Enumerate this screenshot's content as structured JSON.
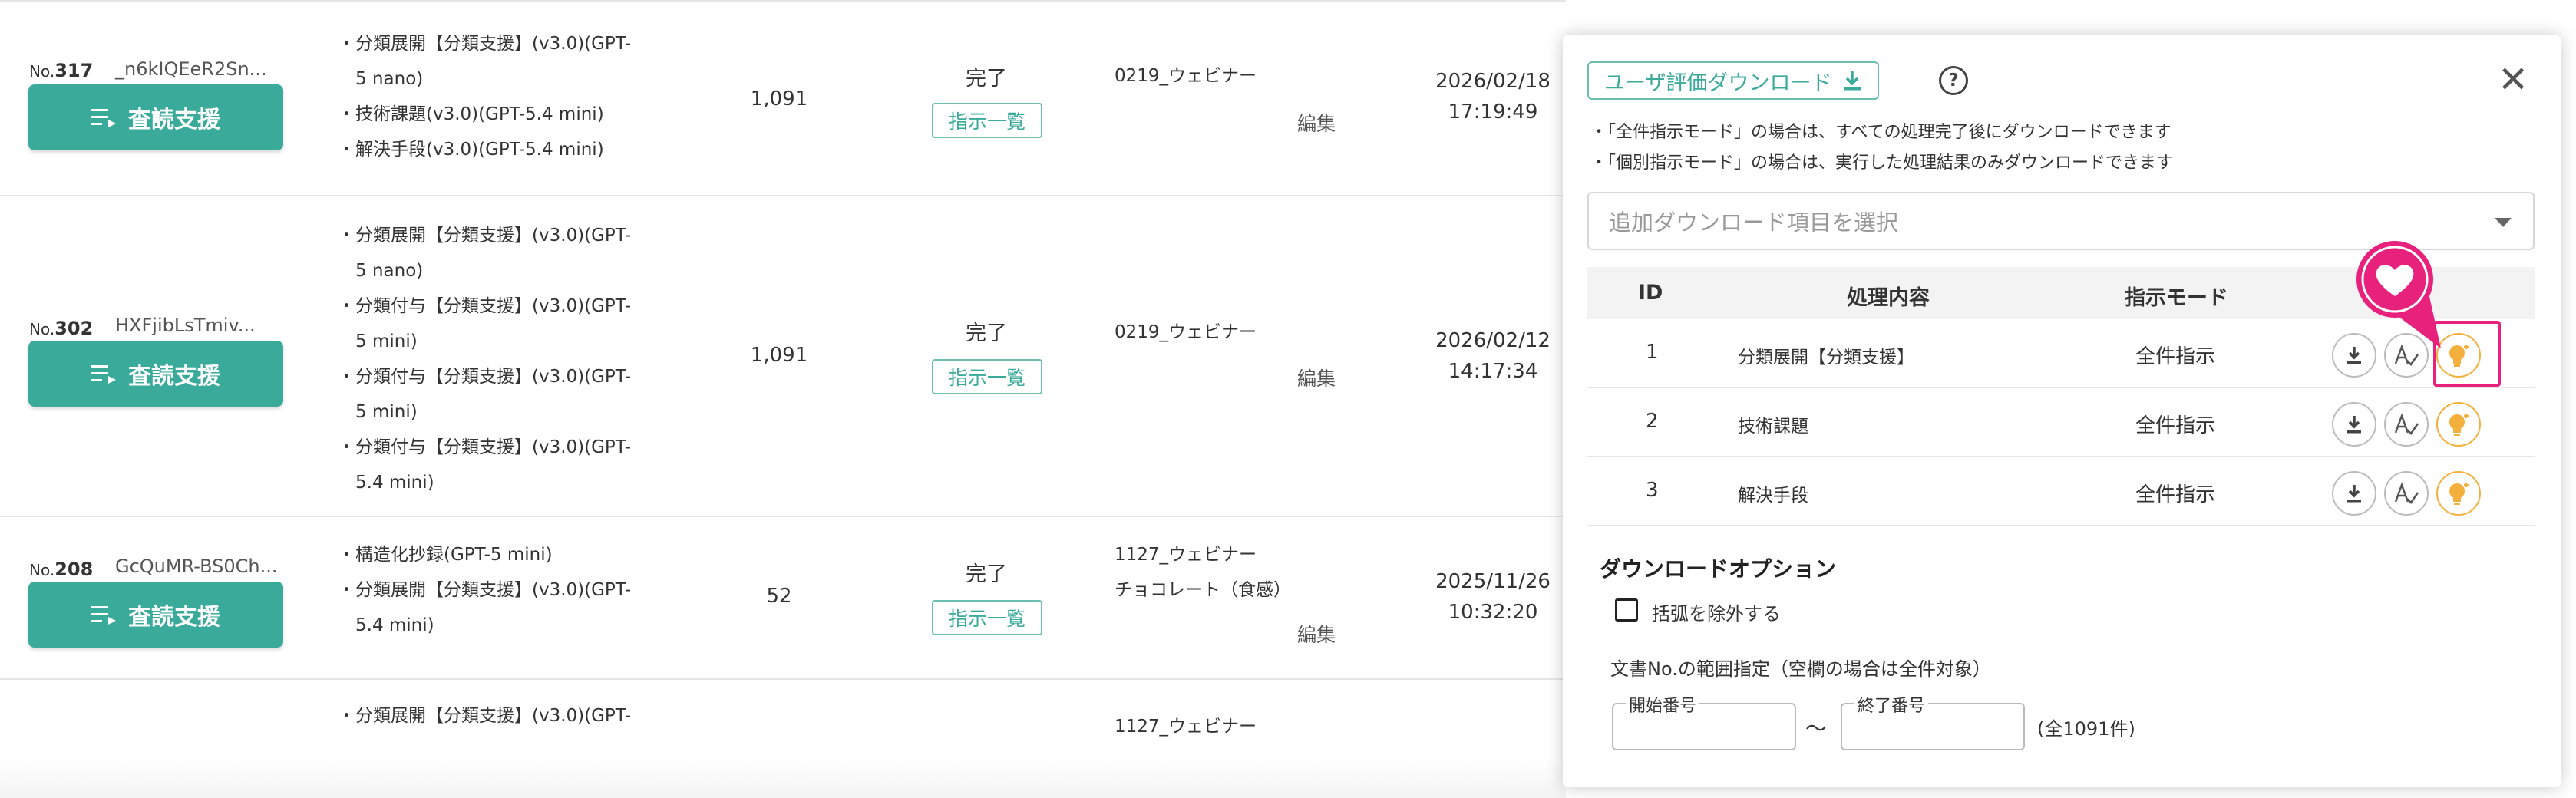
{
  "rows": [
    {
      "no_prefix": "No.",
      "no": "317",
      "code": "_n6kIQEeR2Sn...",
      "button": "査読支援",
      "tasks": [
        "・分類展開【分類支援】(v3.0)(GPT-",
        "　5 nano)",
        "・技術課題(v3.0)(GPT-5.4 mini)",
        "・解決手段(v3.0)(GPT-5.4 mini)"
      ],
      "count": "1,091",
      "status": "完了",
      "instruction_link": "指示一覧",
      "webinar": [
        "0219_ウェビナー"
      ],
      "edit": "編集",
      "date": "2026/02/18",
      "time": "17:19:49"
    },
    {
      "no_prefix": "No.",
      "no": "302",
      "code": "HXFjibLsTmiv...",
      "button": "査読支援",
      "tasks": [
        "・分類展開【分類支援】(v3.0)(GPT-",
        "　5 nano)",
        "・分類付与【分類支援】(v3.0)(GPT-",
        "　5 mini)",
        "・分類付与【分類支援】(v3.0)(GPT-",
        "　5 mini)",
        "・分類付与【分類支援】(v3.0)(GPT-",
        "　5.4 mini)"
      ],
      "count": "1,091",
      "status": "完了",
      "instruction_link": "指示一覧",
      "webinar": [
        "0219_ウェビナー"
      ],
      "edit": "編集",
      "date": "2026/02/12",
      "time": "14:17:34"
    },
    {
      "no_prefix": "No.",
      "no": "208",
      "code": "GcQuMR-BS0Ch...",
      "button": "査読支援",
      "tasks": [
        "・構造化抄録(GPT-5 mini)",
        "・分類展開【分類支援】(v3.0)(GPT-",
        "　5.4 mini)"
      ],
      "count": "52",
      "status": "完了",
      "instruction_link": "指示一覧",
      "webinar": [
        "1127_ウェビナー",
        "チョコレート（食感）"
      ],
      "edit": "編集",
      "date": "2025/11/26",
      "time": "10:32:20"
    },
    {
      "tasks": [
        "・分類展開【分類支援】(v3.0)(GPT-"
      ],
      "webinar": [
        "1127_ウェビナー"
      ]
    }
  ],
  "panel": {
    "download_button": "ユーザ評価ダウンロード",
    "help": "?",
    "close": "✕",
    "notes": [
      "・「全件指示モード」の場合は、すべての処理完了後にダウンロードできます",
      "・「個別指示モード」の場合は、実行した処理結果のみダウンロードできます"
    ],
    "select_placeholder": "追加ダウンロード項目を選択",
    "table": {
      "headers": {
        "id": "ID",
        "process": "処理内容",
        "mode": "指示モード"
      },
      "rows": [
        {
          "id": "1",
          "process": "分類展開【分類支援】",
          "mode": "全件指示"
        },
        {
          "id": "2",
          "process": "技術課題",
          "mode": "全件指示"
        },
        {
          "id": "3",
          "process": "解決手段",
          "mode": "全件指示"
        }
      ]
    },
    "options_title": "ダウンロードオプション",
    "exclude_brackets": "括弧を除外する",
    "range_label": "文書No.の範囲指定（空欄の場合は全件対象）",
    "start_label": "開始番号",
    "tilde": "〜",
    "end_label": "終了番号",
    "total": "(全1091件)"
  },
  "colors": {
    "accent": "#3aaa9a",
    "highlight": "#e8217c",
    "bulb": "#f4b03c"
  }
}
